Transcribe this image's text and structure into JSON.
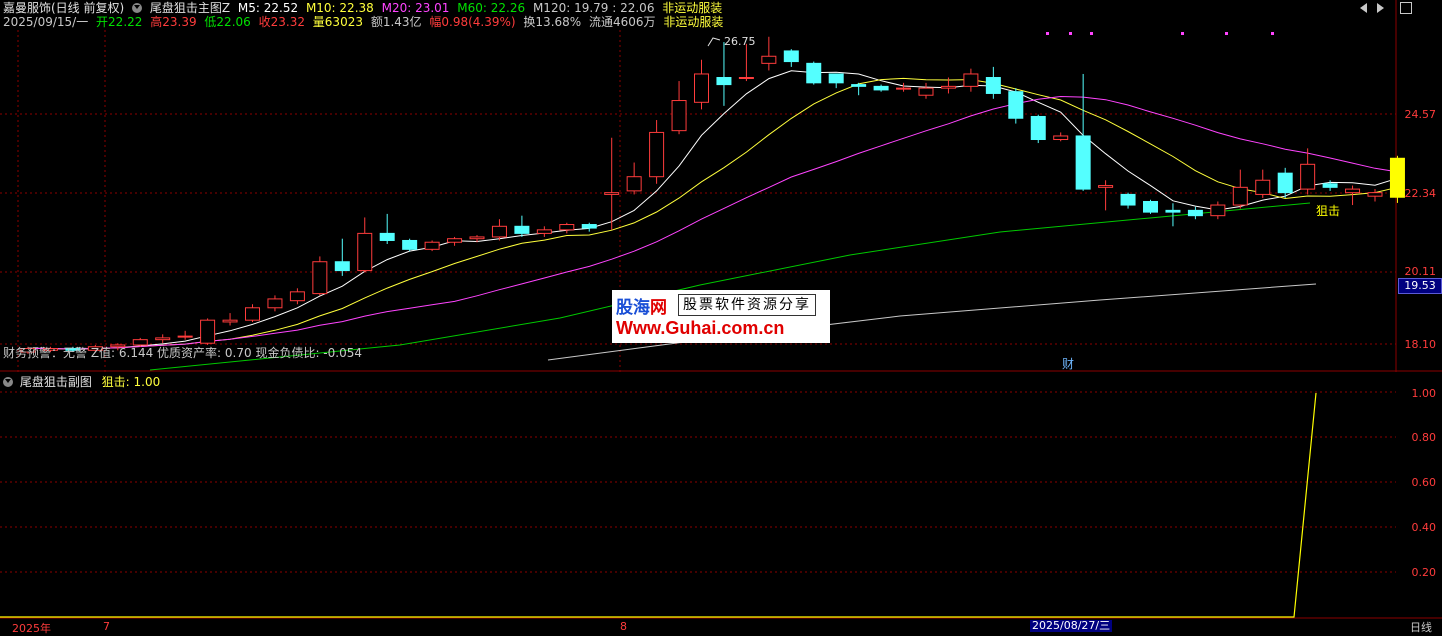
{
  "title_bar": {
    "stock": "嘉曼服饰(日线 前复权)",
    "indicator": "尾盘狙击主图Z",
    "ma5": "M5: 22.52",
    "ma10": "M10: 22.38",
    "ma20": "M20: 23.01",
    "ma60": "M60: 22.26",
    "ma120": "M120: 19.79 : 22.06",
    "tag": "非运动服装"
  },
  "quote_bar": {
    "date": "2025/09/15/一",
    "open": "开22.22",
    "high": "高23.39",
    "low": "低22.06",
    "close": "收23.32",
    "volume": "量63023",
    "amount": "额1.43亿",
    "change": "幅0.98(4.39%)",
    "turnover": "换13.68%",
    "float": "流通4606万",
    "sector": "非运动服装"
  },
  "colors": {
    "up": "#ff3c3c",
    "down": "#54ffff",
    "ma5": "#ffffff",
    "ma10": "#ffff3c",
    "ma20": "#ff44ff",
    "ma60": "#00c800",
    "ma120": "#c8c8c8",
    "grid": "#8b0000",
    "signal": "#ffff00"
  },
  "price_axis": [
    "24.57",
    "22.34",
    "20.11",
    "18.10"
  ],
  "current_price_tag": "19.53",
  "high_annotation": "26.75",
  "signal_label": "狙击",
  "finance_line": "财务预警：无警 Z值: 6.144 优质资产率: 0.70 现金负债比: -0.054",
  "finance_marker": "财",
  "watermark": {
    "brand_blue": "股海",
    "brand_red": "网",
    "slogan": "股票软件资源分享",
    "url": "Www.Guhai.com.cn"
  },
  "sub_chart": {
    "title": "尾盘狙击副图",
    "value_label": "狙击: 1.00",
    "axis": [
      "1.00",
      "0.80",
      "0.60",
      "0.40",
      "0.20"
    ]
  },
  "bottom_axis": {
    "year": "2025年",
    "month7": "7",
    "month8": "8",
    "highlight": "2025/08/27/三",
    "period": "日线"
  },
  "top_right_icons": [
    "prev-icon",
    "next-icon",
    "restore-icon"
  ],
  "chart_data": {
    "type": "candlestick",
    "candles": [
      [
        17.85,
        17.95,
        17.8,
        18.0
      ],
      [
        17.9,
        17.95,
        17.85,
        18.0
      ],
      [
        17.95,
        17.9,
        17.85,
        18.0
      ],
      [
        17.9,
        18.0,
        17.85,
        18.05
      ],
      [
        18.0,
        18.05,
        17.9,
        18.1
      ],
      [
        18.05,
        18.2,
        18.0,
        18.25
      ],
      [
        18.2,
        18.25,
        18.1,
        18.35
      ],
      [
        18.3,
        18.3,
        18.2,
        18.45
      ],
      [
        18.1,
        18.75,
        18.05,
        18.8
      ],
      [
        18.7,
        18.75,
        18.6,
        18.95
      ],
      [
        18.75,
        19.1,
        18.7,
        19.2
      ],
      [
        19.1,
        19.35,
        19.0,
        19.45
      ],
      [
        19.3,
        19.55,
        19.2,
        19.65
      ],
      [
        19.5,
        20.4,
        19.45,
        20.55
      ],
      [
        20.4,
        20.15,
        20.0,
        21.05
      ],
      [
        20.15,
        21.2,
        20.1,
        21.65
      ],
      [
        21.2,
        21.0,
        20.9,
        21.75
      ],
      [
        21.0,
        20.75,
        20.7,
        21.05
      ],
      [
        20.75,
        20.95,
        20.7,
        21.0
      ],
      [
        20.95,
        21.05,
        20.85,
        21.1
      ],
      [
        21.05,
        21.1,
        20.95,
        21.15
      ],
      [
        21.1,
        21.4,
        21.0,
        21.6
      ],
      [
        21.4,
        21.2,
        21.1,
        21.7
      ],
      [
        21.2,
        21.3,
        21.1,
        21.4
      ],
      [
        21.3,
        21.45,
        21.2,
        21.5
      ],
      [
        21.45,
        21.35,
        21.25,
        21.5
      ],
      [
        22.3,
        22.35,
        21.3,
        23.9
      ],
      [
        22.4,
        22.8,
        22.3,
        23.2
      ],
      [
        22.8,
        24.05,
        22.6,
        24.4
      ],
      [
        24.1,
        24.95,
        24.0,
        25.5
      ],
      [
        24.9,
        25.7,
        24.7,
        26.1
      ],
      [
        25.6,
        25.4,
        24.8,
        26.6
      ],
      [
        25.6,
        25.6,
        25.5,
        26.55
      ],
      [
        26.0,
        26.2,
        25.8,
        26.75
      ],
      [
        26.35,
        26.05,
        25.9,
        26.4
      ],
      [
        26.0,
        25.45,
        25.4,
        26.05
      ],
      [
        25.7,
        25.45,
        25.3,
        25.7
      ],
      [
        25.4,
        25.35,
        25.1,
        25.45
      ],
      [
        25.35,
        25.25,
        25.2,
        25.4
      ],
      [
        25.3,
        25.3,
        25.2,
        25.45
      ],
      [
        25.1,
        25.3,
        25.0,
        25.45
      ],
      [
        25.3,
        25.35,
        25.15,
        25.6
      ],
      [
        25.35,
        25.7,
        25.2,
        25.85
      ],
      [
        25.6,
        25.15,
        25.0,
        25.9
      ],
      [
        25.2,
        24.45,
        24.3,
        25.3
      ],
      [
        24.5,
        23.85,
        23.75,
        24.55
      ],
      [
        23.85,
        23.95,
        23.8,
        24.05
      ],
      [
        23.95,
        22.45,
        22.4,
        25.7
      ],
      [
        22.5,
        22.55,
        21.85,
        22.7
      ],
      [
        22.3,
        22.0,
        21.9,
        22.35
      ],
      [
        22.1,
        21.8,
        21.75,
        22.15
      ],
      [
        21.85,
        21.8,
        21.4,
        22.05
      ],
      [
        21.85,
        21.7,
        21.6,
        21.95
      ],
      [
        21.7,
        22.0,
        21.6,
        22.1
      ],
      [
        22.0,
        22.5,
        21.9,
        23.0
      ],
      [
        22.3,
        22.7,
        22.2,
        23.0
      ],
      [
        22.9,
        22.35,
        22.2,
        23.05
      ],
      [
        22.45,
        23.15,
        22.3,
        23.6
      ],
      [
        22.6,
        22.5,
        22.4,
        22.7
      ],
      [
        22.35,
        22.45,
        22.0,
        22.55
      ],
      [
        22.25,
        22.35,
        22.1,
        22.45
      ],
      [
        22.22,
        23.32,
        22.06,
        23.39
      ]
    ]
  }
}
